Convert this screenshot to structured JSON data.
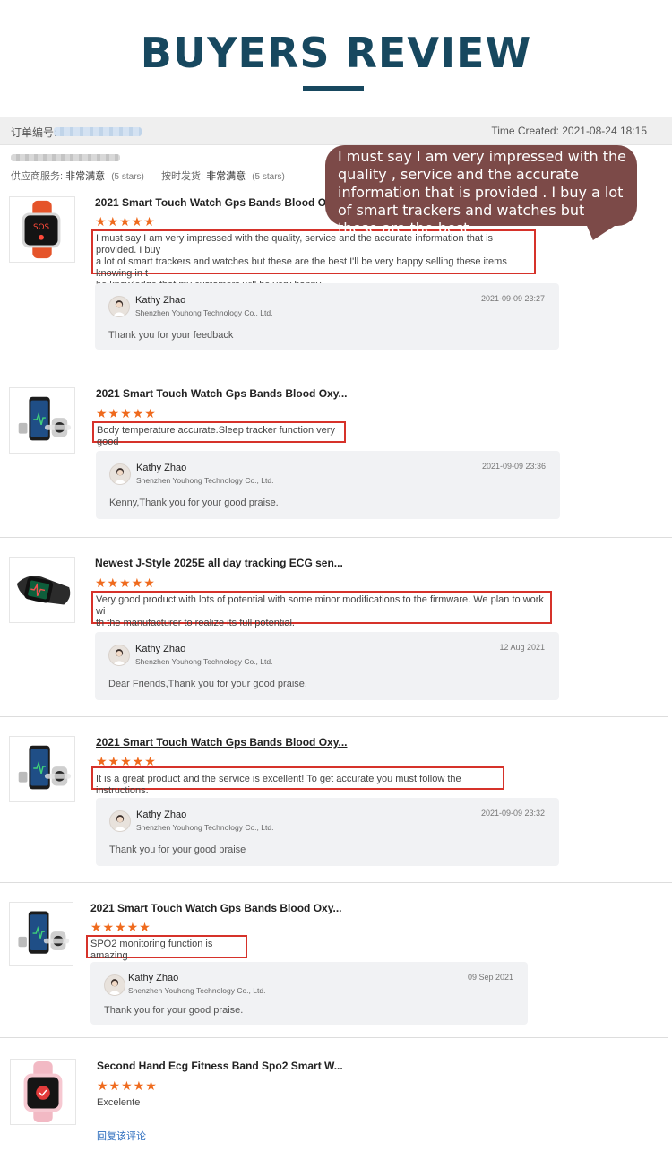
{
  "header": {
    "title": "BUYERS REVIEW"
  },
  "order": {
    "label": "订单编号:",
    "time_created": "Time Created: 2021-08-24 18:15",
    "supplier_service_label": "供应商服务:",
    "supplier_service_value": "非常满意",
    "supplier_service_stars": "(5 stars)",
    "ontime_label": "按时发货:",
    "ontime_value": "非常满意",
    "ontime_stars": "(5 stars)"
  },
  "callout": {
    "text": "I must say I am very impressed with the quality , service and the accurate information that is provided . I buy a lot of smart trackers and watches but these are the best"
  },
  "colors": {
    "title": "#17485f",
    "stars": "#ef6a1d",
    "highlight_border": "#d6322a",
    "callout_bg": "#7c4a48",
    "link": "#2f6fbf"
  },
  "reviews": [
    {
      "product_title": "2021 Smart Touch Watch Gps Bands Blood Oxy...",
      "thumb_icon": "orange-smartwatch-sos-icon",
      "stars": "★★★★★",
      "text_lines": [
        "I must say I am very impressed with the quality, service and the accurate information that is provided. I buy",
        "a lot of smart trackers and watches but these are the best I'll be very happy selling these items knowing in t",
        "he knowledge that my customers will be very happy"
      ],
      "reply": {
        "name": "Kathy Zhao",
        "company": "Shenzhen Youhong Technology Co., Ltd.",
        "date": "2021-09-09 23:27",
        "message": "Thank you for your feedback"
      }
    },
    {
      "product_title": "2021 Smart Touch Watch Gps Bands Blood Oxy...",
      "thumb_icon": "phone-and-watch-icon",
      "stars": "★★★★★",
      "text_lines": [
        "Body temperature accurate.Sleep tracker function very good"
      ],
      "reply": {
        "name": "Kathy Zhao",
        "company": "Shenzhen Youhong Technology Co., Ltd.",
        "date": "2021-09-09 23:36",
        "message": "Kenny,Thank you for your good praise."
      }
    },
    {
      "product_title": "Newest J-Style 2025E all day tracking ECG sen...",
      "thumb_icon": "black-ecg-band-icon",
      "stars": "★★★★★",
      "text_lines": [
        "Very good product with lots of potential with some minor modifications to the firmware. We plan to work wi",
        "th the manufacturer to realize its full potential."
      ],
      "reply": {
        "name": "Kathy Zhao",
        "company": "Shenzhen Youhong Technology Co., Ltd.",
        "date": "12 Aug 2021",
        "message": "Dear Friends,Thank you for your good praise,"
      }
    },
    {
      "product_title": "2021 Smart Touch Watch Gps Bands Blood Oxy...",
      "thumb_icon": "phone-and-watch-icon",
      "stars": "★★★★★",
      "text_lines": [
        "It is a great product and the service is excellent! To get accurate you must follow the instructions."
      ],
      "reply": {
        "name": "Kathy Zhao",
        "company": "Shenzhen Youhong Technology Co., Ltd.",
        "date": "2021-09-09 23:32",
        "message": "Thank you for your good praise"
      }
    },
    {
      "product_title": "2021 Smart Touch Watch Gps Bands Blood Oxy...",
      "thumb_icon": "phone-and-watch-icon",
      "stars": "★★★★★",
      "text_lines": [
        "SPO2 monitoring function is amazing"
      ],
      "reply": {
        "name": "Kathy Zhao",
        "company": "Shenzhen Youhong Technology Co., Ltd.",
        "date": "09 Sep 2021",
        "message": "Thank you for your good praise."
      }
    },
    {
      "product_title": "Second Hand Ecg Fitness Band Spo2 Smart W...",
      "thumb_icon": "pink-smartwatch-icon",
      "stars": "★★★★★",
      "text": "Excelente",
      "reply_link": "回复该评论"
    }
  ]
}
